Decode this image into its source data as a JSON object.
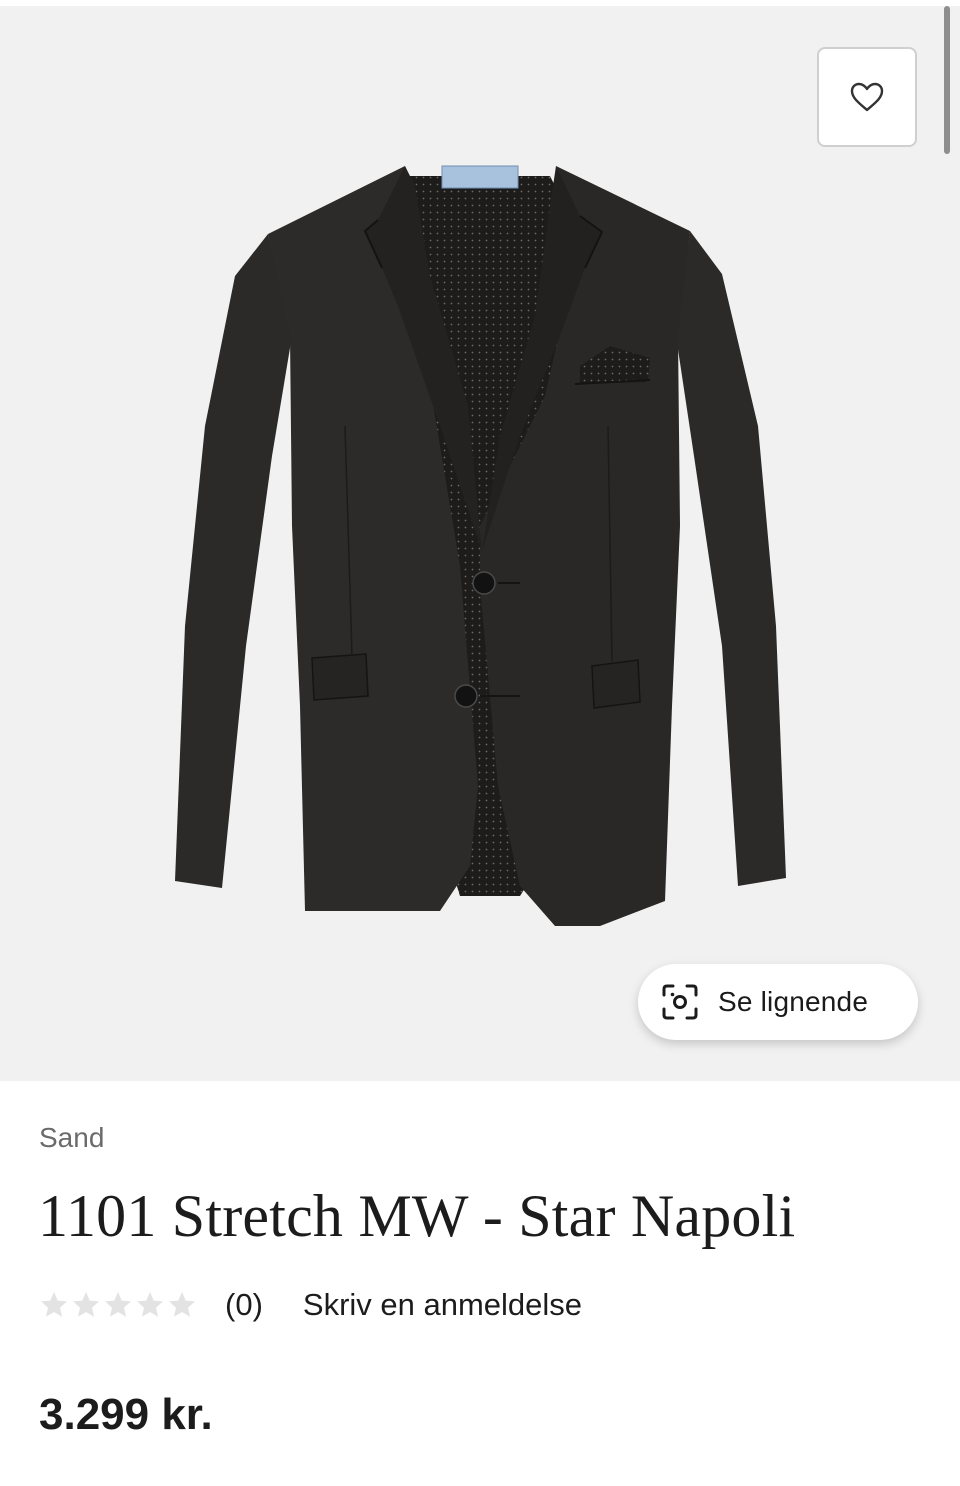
{
  "product": {
    "brand": "Sand",
    "title": "1101 Stretch MW - Star Napoli",
    "rating": {
      "value": 0,
      "max": 5
    },
    "review_count": "(0)",
    "write_review_label": "Skriv en anmeldelse",
    "price": "3.299 kr."
  },
  "image_actions": {
    "similar_label": "Se lignende"
  },
  "icons": {
    "favorite": "heart-icon",
    "similar": "visual-search-icon",
    "rating": "star-icon"
  },
  "colors": {
    "image_background": "#f1f1f1",
    "jacket": "#2a2826",
    "text": "#1c1c1c",
    "muted_text": "#6b6b6b",
    "empty_star": "#e3e3e3"
  }
}
